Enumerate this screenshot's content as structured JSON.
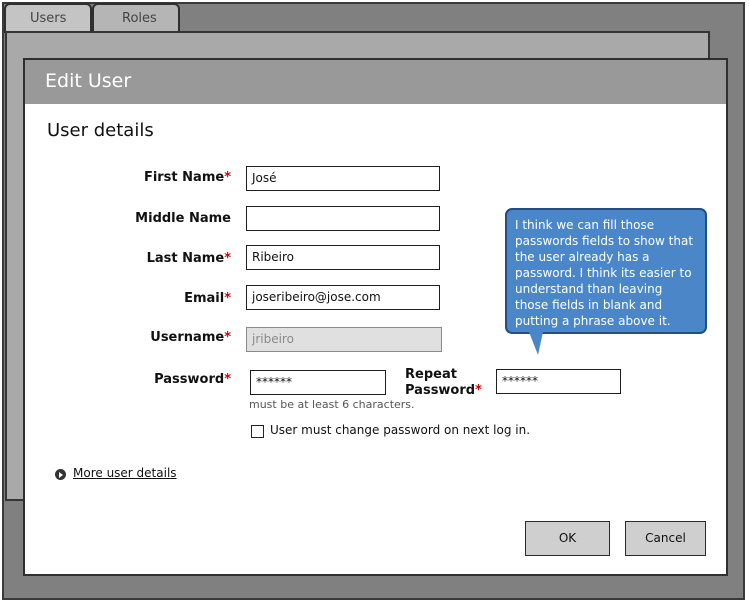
{
  "tabs": [
    {
      "label": "Users"
    },
    {
      "label": "Roles"
    }
  ],
  "dialog": {
    "title": "Edit User",
    "section_title": "User details",
    "required_mark": "*",
    "fields": {
      "first_name": {
        "label": "First Name",
        "value": "José"
      },
      "middle_name": {
        "label": "Middle Name",
        "value": ""
      },
      "last_name": {
        "label": "Last Name",
        "value": "Ribeiro"
      },
      "email": {
        "label": "Email",
        "value": "joseribeiro@jose.com"
      },
      "username": {
        "label": "Username",
        "value": "jribeiro"
      },
      "password": {
        "label": "Password",
        "value": "******",
        "hint": "must be at least 6 characters."
      },
      "repeat_password": {
        "label_line1": "Repeat",
        "label_line2": "Password",
        "value": "******"
      }
    },
    "change_password_checkbox": {
      "label": "User must change password on next log in.",
      "checked": false
    },
    "more_details_link": "More user details",
    "buttons": {
      "ok": "OK",
      "cancel": "Cancel"
    }
  },
  "annotation": {
    "text": "I think we can fill those passwords fields to show that the user already has a password. I think its easier to understand than leaving those fields in blank and putting a phrase above it."
  },
  "colors": {
    "required": "#cc0000",
    "callout": "#4a86c8",
    "header": "#999999"
  }
}
